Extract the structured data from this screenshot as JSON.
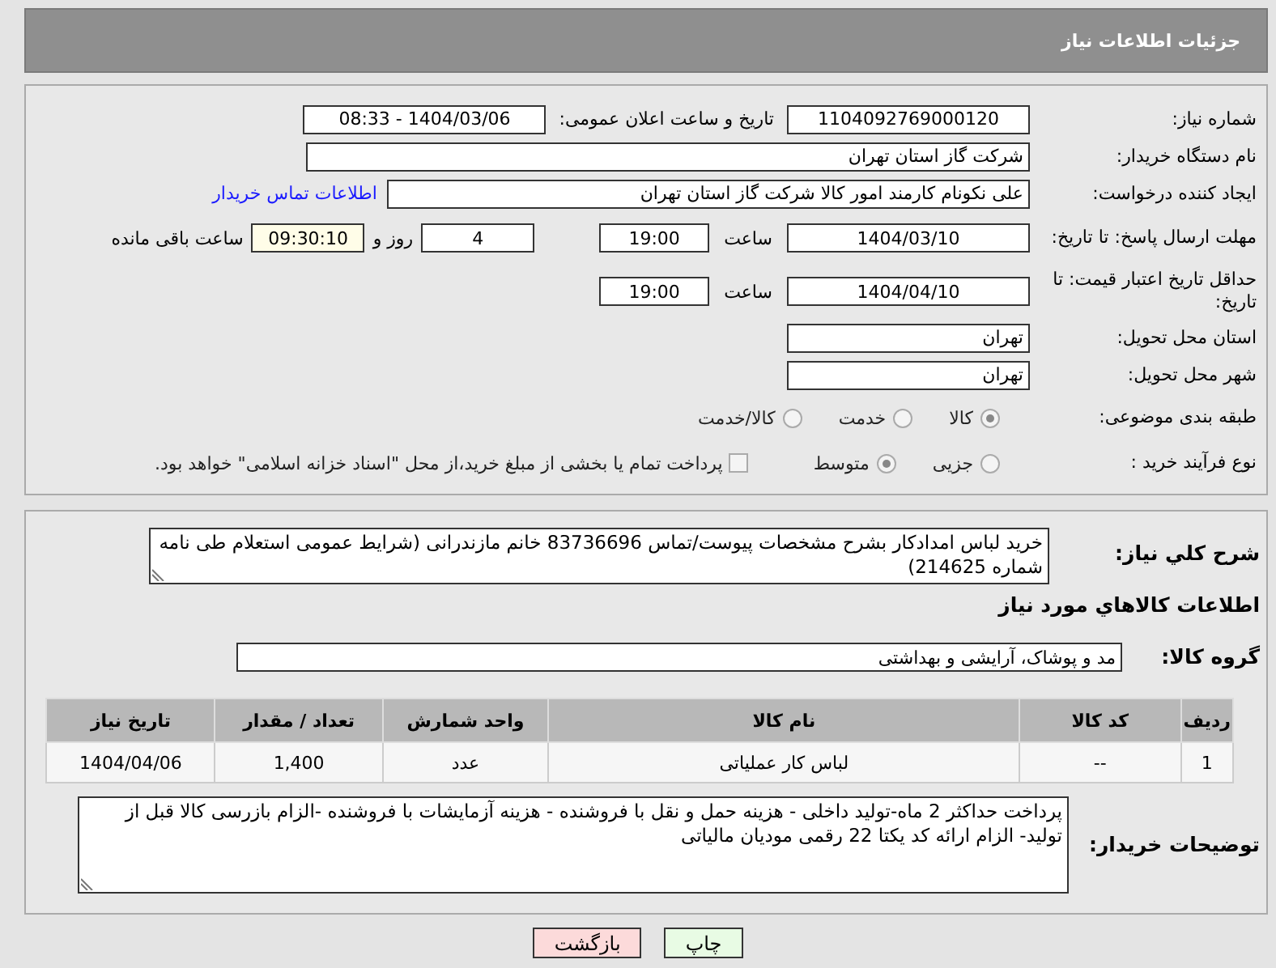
{
  "header": {
    "title": "جزئیات اطلاعات نیاز"
  },
  "need_number": {
    "label": "شماره نیاز:",
    "value": "1104092769000120"
  },
  "announce": {
    "label": "تاریخ و ساعت اعلان عمومی:",
    "value": "1404/03/06 - 08:33"
  },
  "buyer_org": {
    "label": "نام دستگاه خریدار:",
    "value": "شرکت گاز استان تهران"
  },
  "creator": {
    "label": "ایجاد کننده درخواست:",
    "value": "علی نکونام کارمند امور کالا شرکت گاز استان تهران",
    "link": "اطلاعات تماس خریدار"
  },
  "reply_deadline": {
    "label": "مهلت ارسال پاسخ: تا تاریخ:",
    "date": "1404/03/10",
    "time_label": "ساعت",
    "time": "19:00",
    "days": "4",
    "days_label": "روز و",
    "remaining": "09:30:10",
    "remaining_label": "ساعت باقی مانده"
  },
  "price_validity": {
    "label": "حداقل تاریخ اعتبار قیمت: تا تاریخ:",
    "date": "1404/04/10",
    "time_label": "ساعت",
    "time": "19:00"
  },
  "province": {
    "label": "استان محل تحویل:",
    "value": "تهران"
  },
  "city": {
    "label": "شهر محل تحویل:",
    "value": "تهران"
  },
  "category": {
    "label": "طبقه بندی موضوعی:",
    "options": [
      {
        "label": "کالا",
        "selected": true
      },
      {
        "label": "خدمت",
        "selected": false
      },
      {
        "label": "کالا/خدمت",
        "selected": false
      }
    ]
  },
  "process": {
    "label": "نوع فرآیند خرید :",
    "options": [
      {
        "label": "جزیی",
        "selected": false
      },
      {
        "label": "متوسط",
        "selected": true
      }
    ],
    "treasury": {
      "label": "پرداخت تمام یا بخشی از مبلغ خرید،از محل \"اسناد خزانه اسلامی\" خواهد بود.",
      "checked": false
    }
  },
  "description": {
    "label": "شرح کلي نیاز:",
    "value": "خرید لباس امدادکار بشرح مشخصات پیوست/تماس 83736696 خانم مازندرانی (شرایط عمومی استعلام طی نامه شماره 214625)"
  },
  "goods_heading": "اطلاعات کالاهاي مورد نیاز",
  "goods_group": {
    "label": "گروه کالا:",
    "value": "مد و پوشاک، آرایشی و بهداشتی"
  },
  "table": {
    "columns": [
      "ردیف",
      "کد کالا",
      "نام کالا",
      "واحد شمارش",
      "تعداد / مقدار",
      "تاریخ نیاز"
    ],
    "rows": [
      [
        "1",
        "--",
        "لباس کار عملیاتی",
        "عدد",
        "1,400",
        "1404/04/06"
      ]
    ]
  },
  "buyer_notes": {
    "label": "توضیحات خریدار:",
    "value": "پرداخت حداکثر 2 ماه-تولید داخلی - هزینه حمل و نقل با فروشنده - هزینه آزمایشات با فروشنده -الزام بازرسی کالا قبل از تولید- الزام ارائه کد یکتا 22 رقمی مودیان مالیاتی"
  },
  "buttons": [
    {
      "label": "چاپ",
      "kind": "print"
    },
    {
      "label": "بازگشت",
      "kind": "back"
    }
  ]
}
